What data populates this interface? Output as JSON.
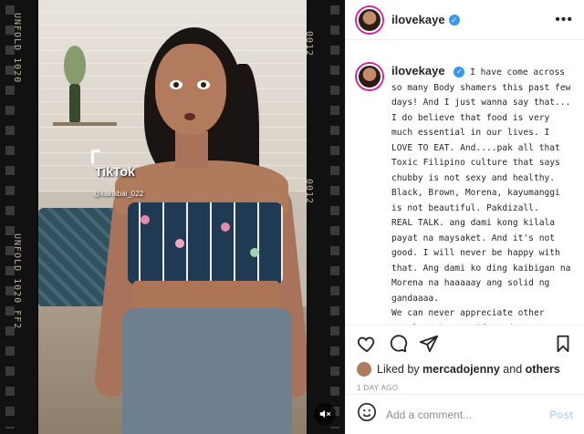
{
  "post": {
    "username": "ilovekaye",
    "verified": true,
    "more_icon": "more-horizontal-icon"
  },
  "media": {
    "film_text_1": "UNFOLD 1020",
    "film_text_2": "UNFOLD 1020 FF2",
    "film_text_3": "0012",
    "film_text_4": "0012",
    "overlay_app": "TikTok",
    "overlay_user": "@kakaibai_022",
    "mute_icon": "speaker-muted-icon"
  },
  "caption": {
    "username": "ilovekaye",
    "text": "I have come across so many Body shamers this past few days! And I just wanna say that...\nI do believe that food is very much essential in our lives. I LOVE TO EAT. And....pak all that Toxic Filipino culture that says chubby is not sexy and healthy. Black, Brown, Morena, kayumanggi is not beautiful. Pakdizall.\nREAL TALK. ang dami kong kilala payat na maysaket. And it's not good. I will never be happy with that. Ang dami ko ding kaibigan na Morena na haaaaay ang solid ng gandaaaa.\nWe can never appreciate other people's beauty if we don't appreciate ours.\nSORRY kung ikakalungkot ng IBA na"
  },
  "actions": {
    "like_icon": "heart-icon",
    "comment_icon": "comment-icon",
    "share_icon": "paper-plane-icon",
    "save_icon": "bookmark-icon",
    "liked_by_prefix": "Liked by",
    "liked_by_user": "mercadojenny",
    "liked_by_and": "and",
    "liked_by_others": "others",
    "timestamp": "1 DAY AGO"
  },
  "comment_input": {
    "emoji_icon": "smiley-icon",
    "placeholder": "Add a comment...",
    "post_label": "Post"
  },
  "colors": {
    "verified": "#3897f0",
    "post_button_disabled": "#b3dbff",
    "muted_text": "#8e8e8e"
  }
}
